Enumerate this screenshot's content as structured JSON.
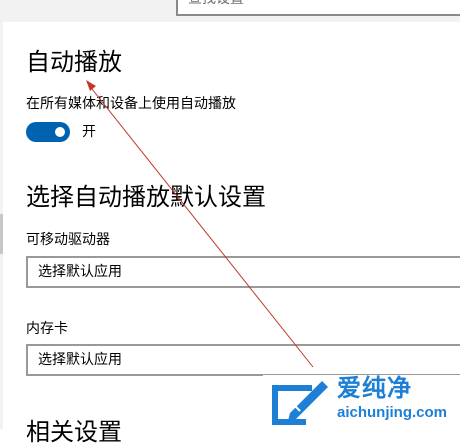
{
  "search": {
    "placeholder": "查找设置"
  },
  "autoplay": {
    "title": "自动播放",
    "use_autoplay_label": "在所有媒体和设备上使用自动播放",
    "toggle_state": "开",
    "toggle_on": true
  },
  "defaults": {
    "title": "选择自动播放默认设置",
    "removable_drive": {
      "label": "可移动驱动器",
      "selected": "选择默认应用"
    },
    "memory_card": {
      "label": "内存卡",
      "selected": "选择默认应用"
    }
  },
  "related": {
    "title": "相关设置"
  },
  "watermark": {
    "brand": "爱纯净",
    "url": "aichunjing.com",
    "color": "#1e7fd6"
  },
  "colors": {
    "accent": "#0063b1",
    "annotation_arrow": "#c0392b"
  },
  "icons": {
    "dropdown": "chevron-down-icon",
    "watermark": "brand-logo-icon"
  }
}
